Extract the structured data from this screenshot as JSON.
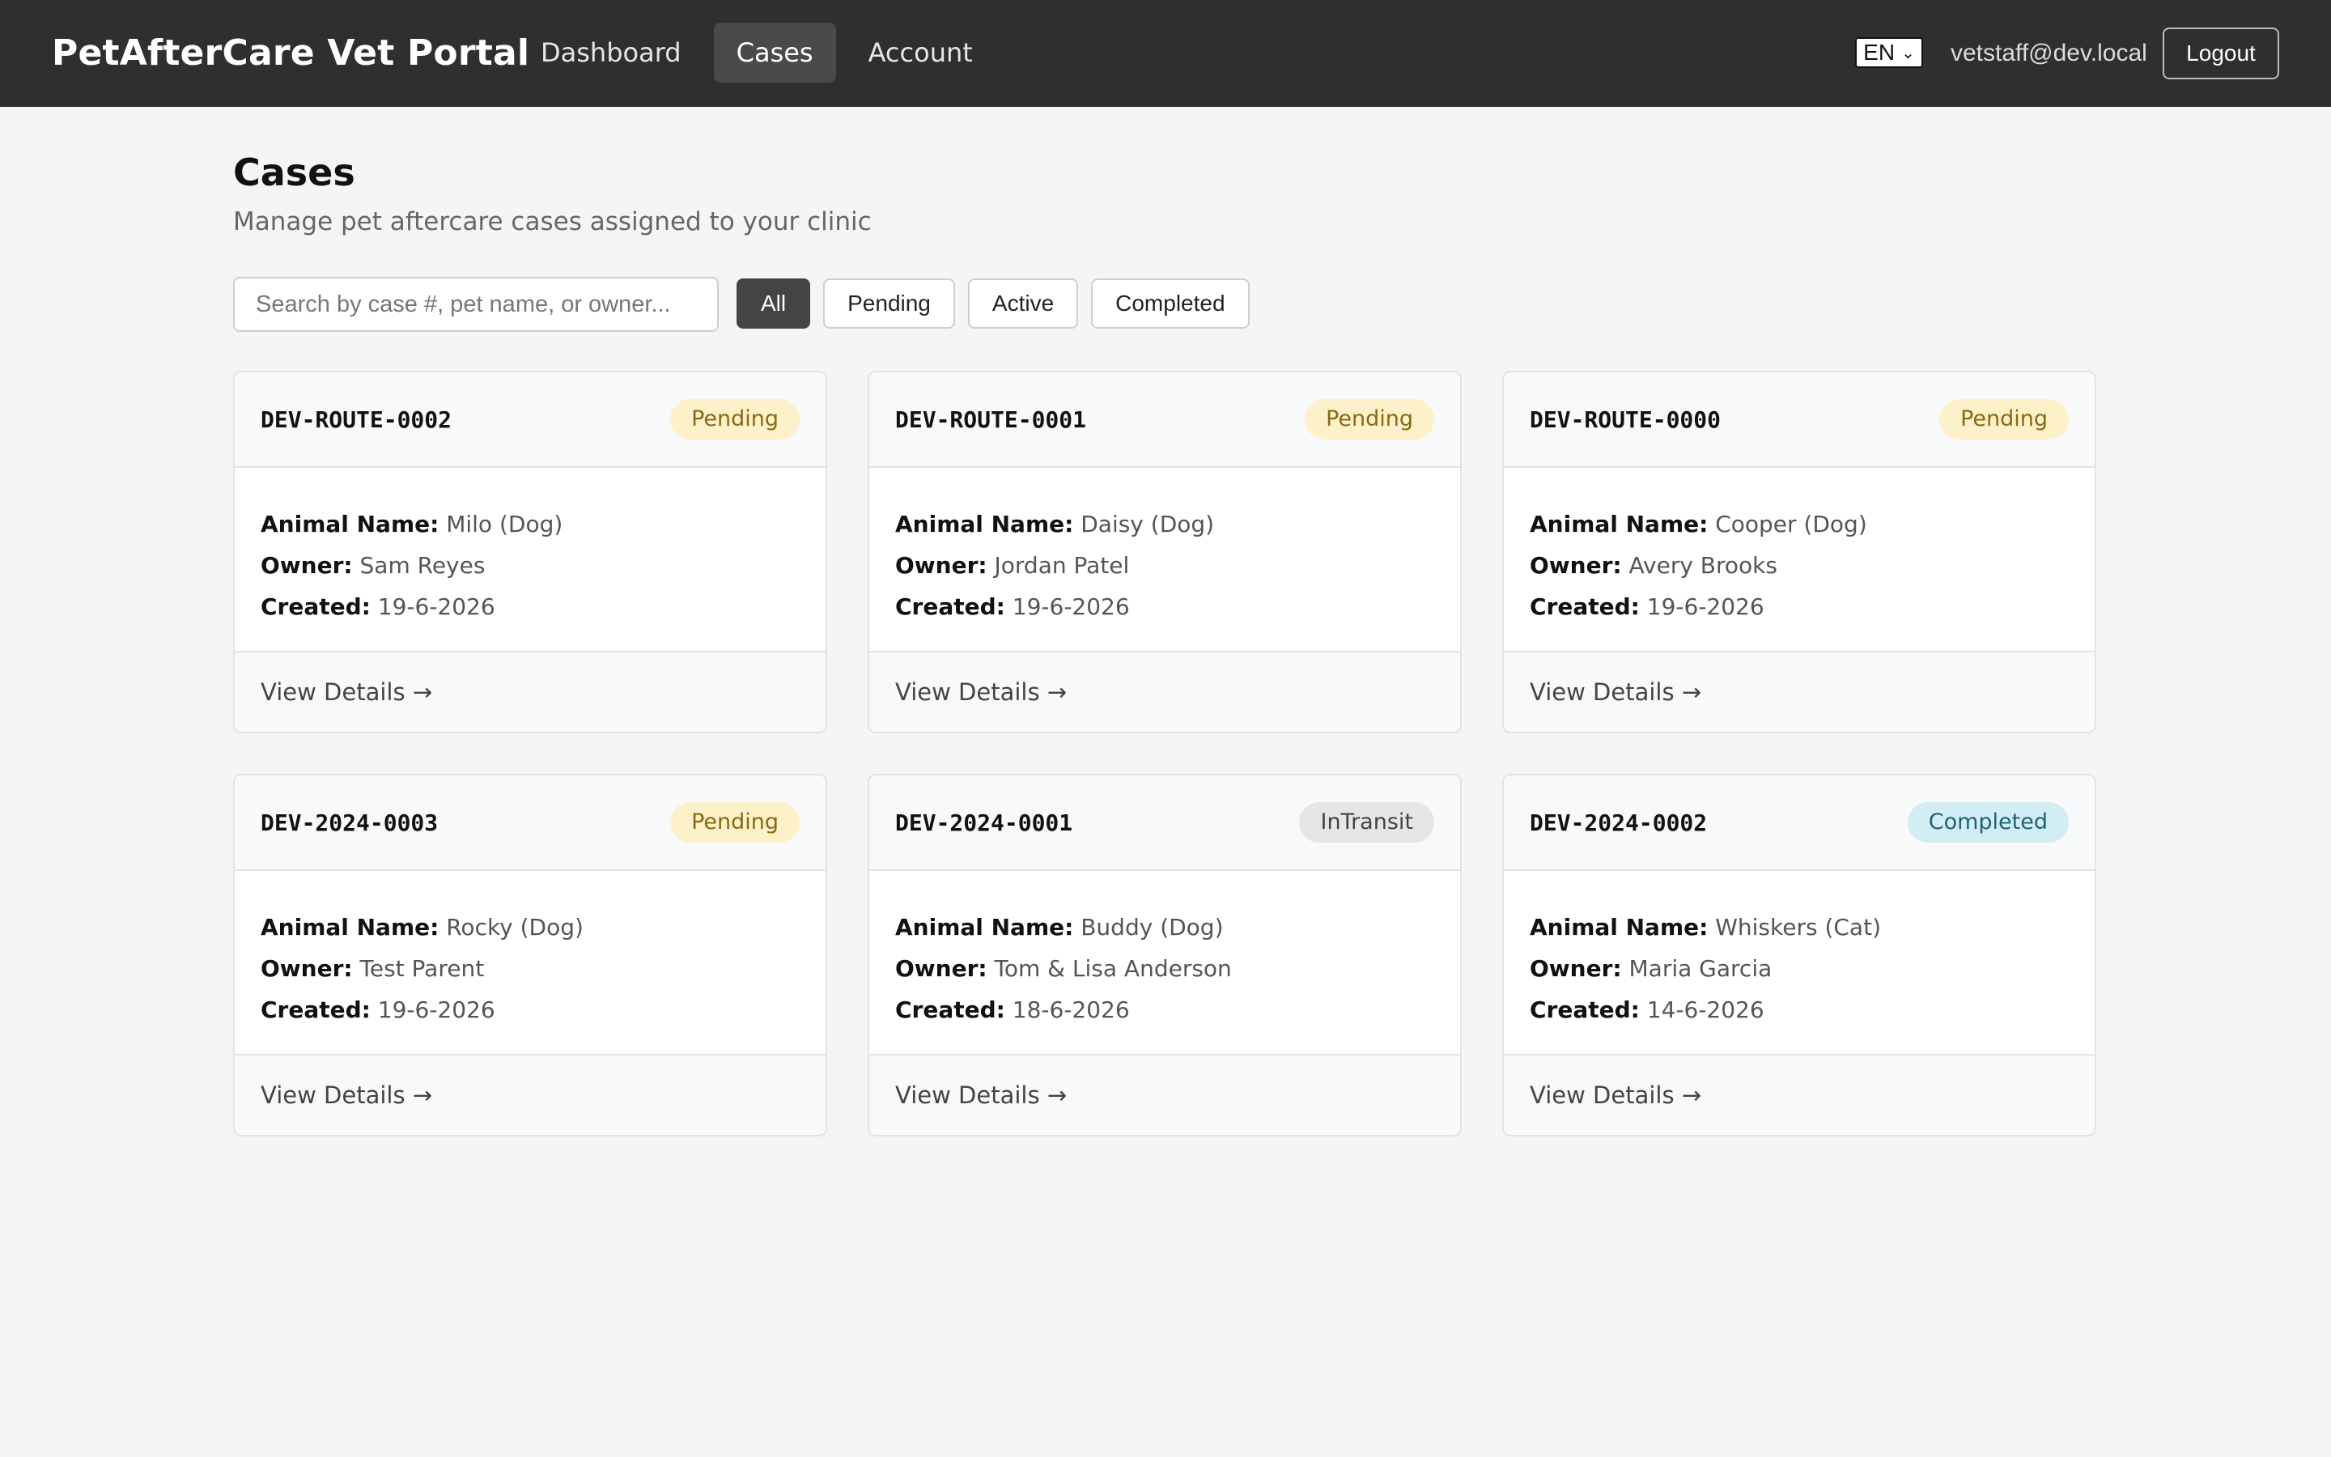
{
  "brand": "PetAfterCare Vet Portal",
  "nav": [
    {
      "label": "Dashboard",
      "active": false
    },
    {
      "label": "Cases",
      "active": true
    },
    {
      "label": "Account",
      "active": false
    }
  ],
  "language": {
    "value": "EN",
    "icon": "chevron-down-icon"
  },
  "user_email": "vetstaff@dev.local",
  "logout_label": "Logout",
  "page": {
    "title": "Cases",
    "subtitle": "Manage pet aftercare cases assigned to your clinic"
  },
  "search": {
    "placeholder": "Search by case #, pet name, or owner...",
    "value": ""
  },
  "filters": [
    {
      "label": "All",
      "active": true
    },
    {
      "label": "Pending",
      "active": false
    },
    {
      "label": "Active",
      "active": false
    },
    {
      "label": "Completed",
      "active": false
    }
  ],
  "labels": {
    "animal": "Animal Name:",
    "owner": "Owner:",
    "created": "Created:",
    "view": "View Details →"
  },
  "colors": {
    "navbar": "#2f2f2f",
    "pending_bg": "#fdf1c9",
    "transit_bg": "#e4e6e8",
    "completed_bg": "#d3edf4"
  },
  "cases": [
    {
      "id": "DEV-ROUTE-0002",
      "status": "Pending",
      "status_kind": "pending",
      "animal": "Milo (Dog)",
      "owner": "Sam Reyes",
      "created": "19-6-2026"
    },
    {
      "id": "DEV-ROUTE-0001",
      "status": "Pending",
      "status_kind": "pending",
      "animal": "Daisy (Dog)",
      "owner": "Jordan Patel",
      "created": "19-6-2026"
    },
    {
      "id": "DEV-ROUTE-0000",
      "status": "Pending",
      "status_kind": "pending",
      "animal": "Cooper (Dog)",
      "owner": "Avery Brooks",
      "created": "19-6-2026"
    },
    {
      "id": "DEV-2024-0003",
      "status": "Pending",
      "status_kind": "pending",
      "animal": "Rocky (Dog)",
      "owner": "Test Parent",
      "created": "19-6-2026"
    },
    {
      "id": "DEV-2024-0001",
      "status": "InTransit",
      "status_kind": "transit",
      "animal": "Buddy (Dog)",
      "owner": "Tom & Lisa Anderson",
      "created": "18-6-2026"
    },
    {
      "id": "DEV-2024-0002",
      "status": "Completed",
      "status_kind": "completed",
      "animal": "Whiskers (Cat)",
      "owner": "Maria Garcia",
      "created": "14-6-2026"
    }
  ]
}
